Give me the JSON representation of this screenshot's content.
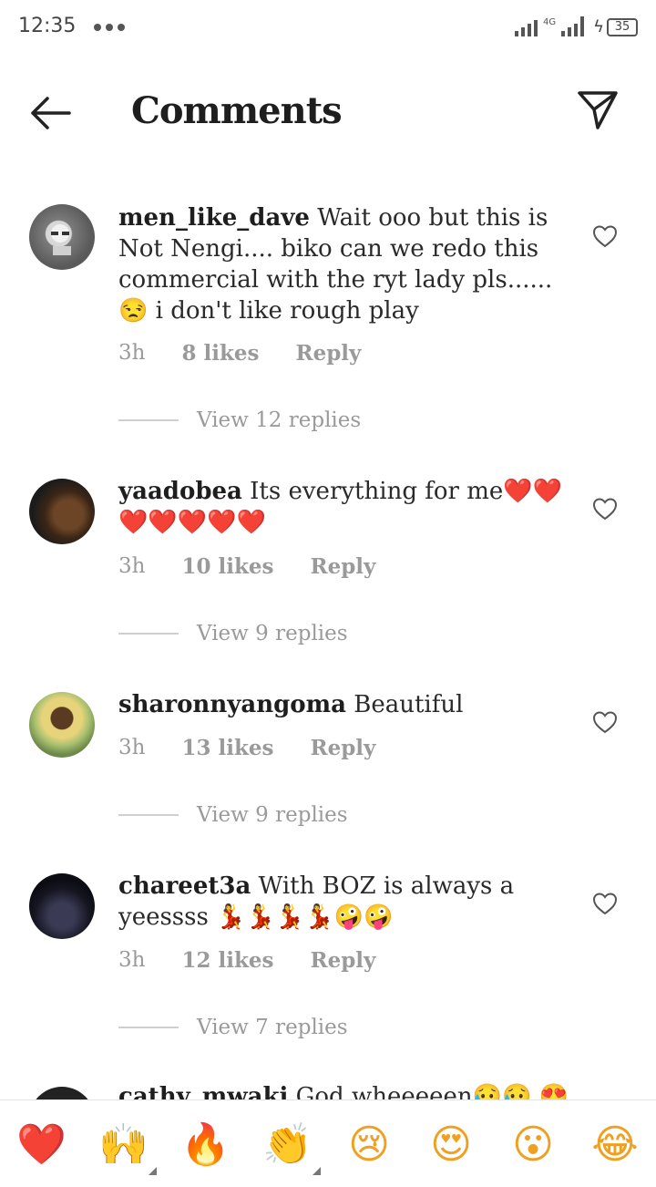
{
  "status_bar": {
    "time": "12:35",
    "network": "4G",
    "battery": "35"
  },
  "header": {
    "title": "Comments"
  },
  "comments": [
    {
      "username": "men_like_dave",
      "text": " Wait ooo but this is Not Nengi.... biko can we redo this commercial with the ryt lady pls...... 😒 i don't like rough play",
      "time": "3h",
      "likes": "8 likes",
      "reply": "Reply",
      "view_replies": "View 12 replies"
    },
    {
      "username": "yaadobea",
      "text": " Its everything for me❤️❤️❤️❤️❤️❤️❤️",
      "time": "3h",
      "likes": "10 likes",
      "reply": "Reply",
      "view_replies": "View 9 replies"
    },
    {
      "username": "sharonnyangoma",
      "text": " Beautiful",
      "time": "3h",
      "likes": "13 likes",
      "reply": "Reply",
      "view_replies": "View 9 replies"
    },
    {
      "username": "chareet3a",
      "text": " With BOZ is always a yeessss 💃💃💃💃🤪🤪",
      "time": "3h",
      "likes": "12 likes",
      "reply": "Reply",
      "view_replies": "View 7 replies"
    }
  ],
  "partial_comment": {
    "username": "cathy_mwaki",
    "text": " God wheeeeen😥😥 😍"
  },
  "emoji_bar": [
    {
      "icon": "red-heart-icon",
      "glyph": "❤️"
    },
    {
      "icon": "raising-hands-icon",
      "glyph": "🙌"
    },
    {
      "icon": "fire-icon",
      "glyph": "🔥"
    },
    {
      "icon": "clapping-hands-icon",
      "glyph": "👏"
    },
    {
      "icon": "crying-face-icon",
      "glyph": "😢"
    },
    {
      "icon": "heart-eyes-icon",
      "glyph": "😍"
    },
    {
      "icon": "surprised-face-icon",
      "glyph": "😮"
    },
    {
      "icon": "tears-of-joy-icon",
      "glyph": "😂"
    }
  ]
}
